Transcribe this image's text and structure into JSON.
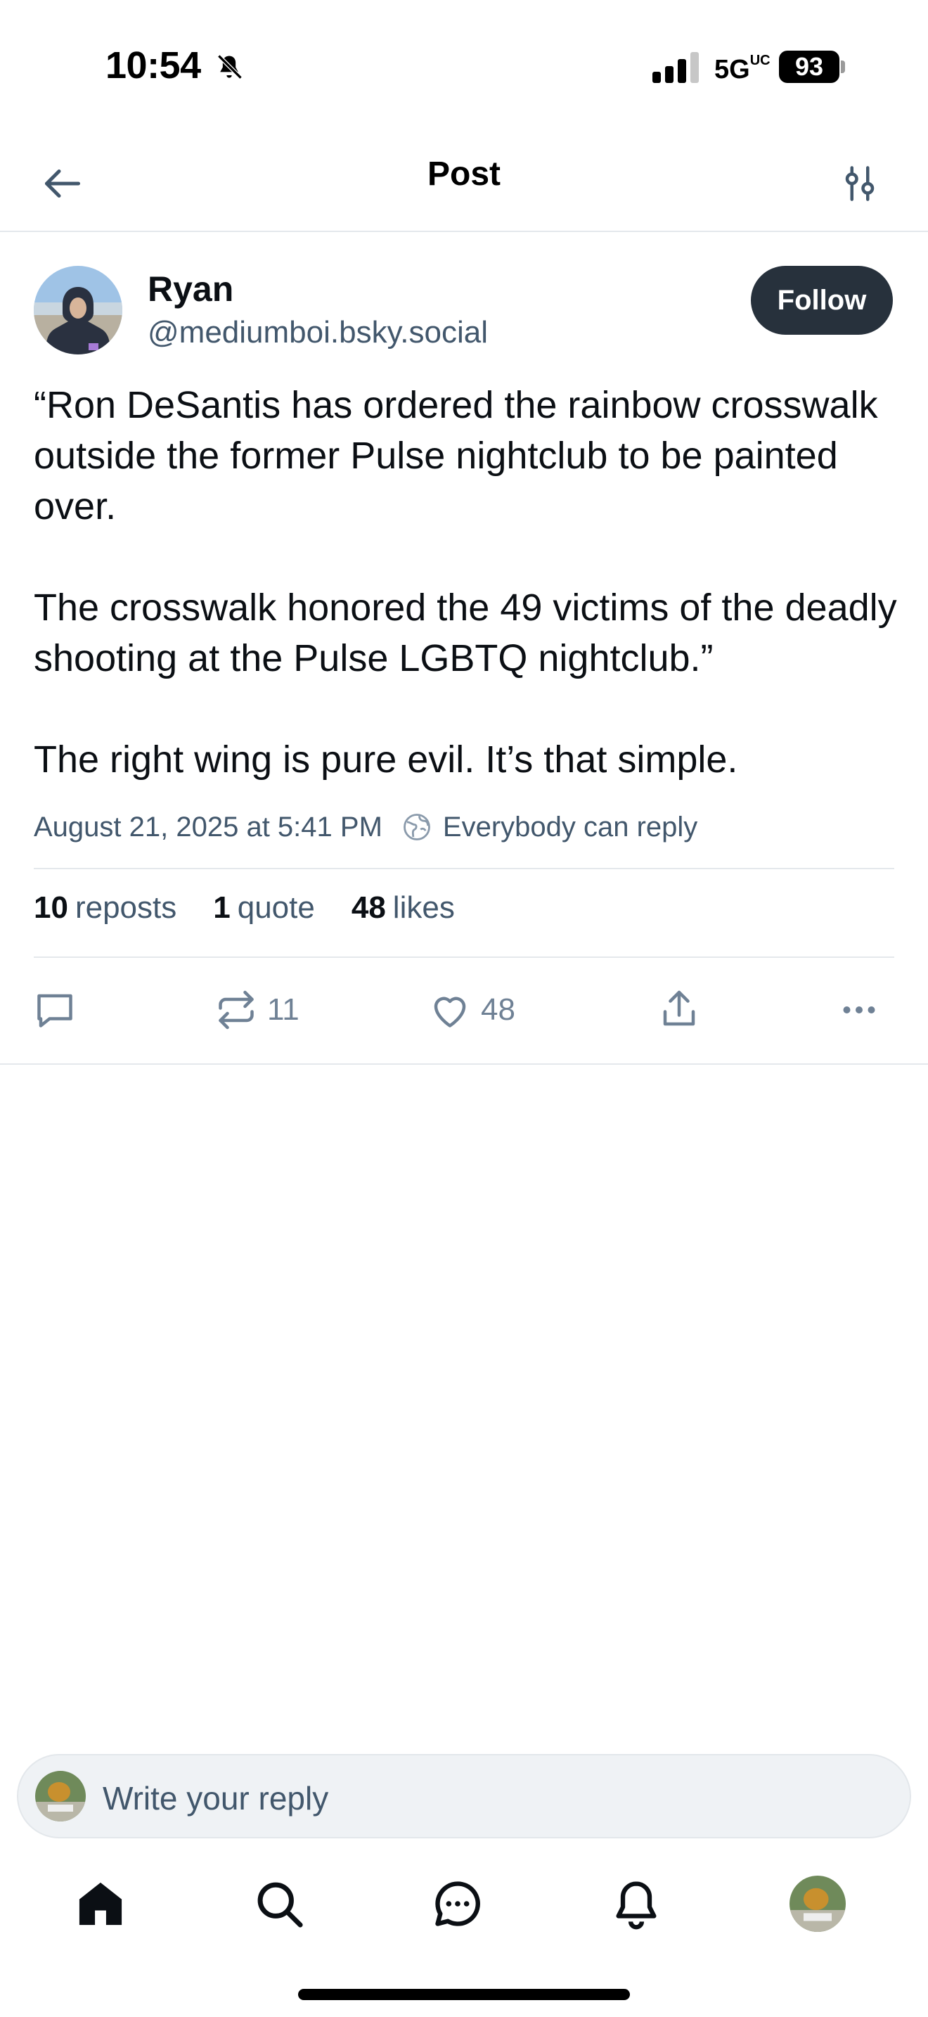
{
  "status_bar": {
    "time": "10:54",
    "network": "5G",
    "network_sup": "UC",
    "battery": "93"
  },
  "header": {
    "title": "Post",
    "back_icon": "arrow-left-icon",
    "settings_icon": "sliders-icon"
  },
  "author": {
    "name": "Ryan",
    "handle": "@mediumboi.bsky.social",
    "follow_label": "Follow"
  },
  "post": {
    "paragraph_1": "“Ron DeSantis has ordered the rainbow crosswalk outside the former Pulse nightclub to be painted over.",
    "paragraph_2": "The crosswalk honored the 49 victims of the deadly shooting at the Pulse LGBTQ nightclub.”",
    "paragraph_3": "The right wing is pure evil. It’s that simple.",
    "timestamp": "August 21, 2025 at 5:41 PM",
    "reply_setting": "Everybody can reply"
  },
  "stats": {
    "reposts_count": "10",
    "reposts_label": "reposts",
    "quotes_count": "1",
    "quotes_label": "quote",
    "likes_count": "48",
    "likes_label": "likes"
  },
  "actions": {
    "repost_count": "11",
    "like_count": "48"
  },
  "composer": {
    "placeholder": "Write your reply"
  },
  "bottom_nav": [
    "home-icon",
    "search-icon",
    "chat-icon",
    "bell-icon",
    "profile-avatar"
  ],
  "colors": {
    "text_primary": "#0b0f14",
    "text_secondary": "#42576c",
    "follow_button_bg": "#27313c",
    "divider": "#e4e8ec",
    "icon_muted": "#6f8195"
  }
}
